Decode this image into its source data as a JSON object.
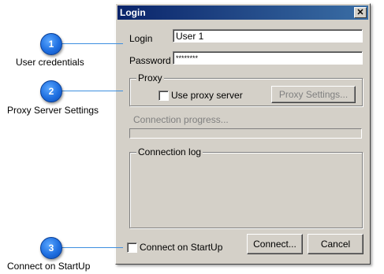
{
  "callouts": [
    {
      "number": "1",
      "label": "User credentials"
    },
    {
      "number": "2",
      "label": "Proxy Server Settings"
    },
    {
      "number": "3",
      "label": "Connect on StartUp"
    }
  ],
  "dialog": {
    "title": "Login",
    "close_glyph": "✕",
    "login_label": "Login",
    "login_value": "User 1",
    "password_label": "Password",
    "password_value": "********",
    "proxy": {
      "group_title": "Proxy",
      "use_proxy_label": "Use proxy server",
      "use_proxy_checked": false,
      "settings_button": "Proxy Settings..."
    },
    "progress_label": "Connection progress...",
    "progress_value": 0,
    "log_title": "Connection log",
    "connect_on_startup_label": "Connect on StartUp",
    "connect_on_startup_checked": false,
    "connect_button": "Connect...",
    "cancel_button": "Cancel"
  }
}
